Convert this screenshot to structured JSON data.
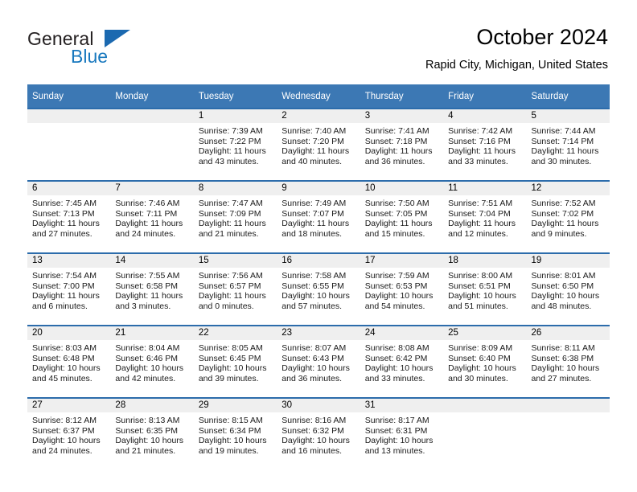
{
  "brand": {
    "name_part1": "General",
    "name_part2": "Blue",
    "accent_color": "#1b69b0"
  },
  "header": {
    "month_title": "October 2024",
    "location": "Rapid City, Michigan, United States"
  },
  "theme": {
    "header_blue": "#3c78b4",
    "row_rule_blue": "#2c6cab",
    "daynum_band": "#efefef"
  },
  "weekday_headers": [
    "Sunday",
    "Monday",
    "Tuesday",
    "Wednesday",
    "Thursday",
    "Friday",
    "Saturday"
  ],
  "labels": {
    "sunrise_prefix": "Sunrise:",
    "sunset_prefix": "Sunset:",
    "daylight_prefix": "Daylight:"
  },
  "weeks": [
    [
      {
        "day": "",
        "sunrise": "",
        "sunset": "",
        "daylight_line1": "",
        "daylight_line2": ""
      },
      {
        "day": "",
        "sunrise": "",
        "sunset": "",
        "daylight_line1": "",
        "daylight_line2": ""
      },
      {
        "day": "1",
        "sunrise": "Sunrise: 7:39 AM",
        "sunset": "Sunset: 7:22 PM",
        "daylight_line1": "Daylight: 11 hours",
        "daylight_line2": "and 43 minutes."
      },
      {
        "day": "2",
        "sunrise": "Sunrise: 7:40 AM",
        "sunset": "Sunset: 7:20 PM",
        "daylight_line1": "Daylight: 11 hours",
        "daylight_line2": "and 40 minutes."
      },
      {
        "day": "3",
        "sunrise": "Sunrise: 7:41 AM",
        "sunset": "Sunset: 7:18 PM",
        "daylight_line1": "Daylight: 11 hours",
        "daylight_line2": "and 36 minutes."
      },
      {
        "day": "4",
        "sunrise": "Sunrise: 7:42 AM",
        "sunset": "Sunset: 7:16 PM",
        "daylight_line1": "Daylight: 11 hours",
        "daylight_line2": "and 33 minutes."
      },
      {
        "day": "5",
        "sunrise": "Sunrise: 7:44 AM",
        "sunset": "Sunset: 7:14 PM",
        "daylight_line1": "Daylight: 11 hours",
        "daylight_line2": "and 30 minutes."
      }
    ],
    [
      {
        "day": "6",
        "sunrise": "Sunrise: 7:45 AM",
        "sunset": "Sunset: 7:13 PM",
        "daylight_line1": "Daylight: 11 hours",
        "daylight_line2": "and 27 minutes."
      },
      {
        "day": "7",
        "sunrise": "Sunrise: 7:46 AM",
        "sunset": "Sunset: 7:11 PM",
        "daylight_line1": "Daylight: 11 hours",
        "daylight_line2": "and 24 minutes."
      },
      {
        "day": "8",
        "sunrise": "Sunrise: 7:47 AM",
        "sunset": "Sunset: 7:09 PM",
        "daylight_line1": "Daylight: 11 hours",
        "daylight_line2": "and 21 minutes."
      },
      {
        "day": "9",
        "sunrise": "Sunrise: 7:49 AM",
        "sunset": "Sunset: 7:07 PM",
        "daylight_line1": "Daylight: 11 hours",
        "daylight_line2": "and 18 minutes."
      },
      {
        "day": "10",
        "sunrise": "Sunrise: 7:50 AM",
        "sunset": "Sunset: 7:05 PM",
        "daylight_line1": "Daylight: 11 hours",
        "daylight_line2": "and 15 minutes."
      },
      {
        "day": "11",
        "sunrise": "Sunrise: 7:51 AM",
        "sunset": "Sunset: 7:04 PM",
        "daylight_line1": "Daylight: 11 hours",
        "daylight_line2": "and 12 minutes."
      },
      {
        "day": "12",
        "sunrise": "Sunrise: 7:52 AM",
        "sunset": "Sunset: 7:02 PM",
        "daylight_line1": "Daylight: 11 hours",
        "daylight_line2": "and 9 minutes."
      }
    ],
    [
      {
        "day": "13",
        "sunrise": "Sunrise: 7:54 AM",
        "sunset": "Sunset: 7:00 PM",
        "daylight_line1": "Daylight: 11 hours",
        "daylight_line2": "and 6 minutes."
      },
      {
        "day": "14",
        "sunrise": "Sunrise: 7:55 AM",
        "sunset": "Sunset: 6:58 PM",
        "daylight_line1": "Daylight: 11 hours",
        "daylight_line2": "and 3 minutes."
      },
      {
        "day": "15",
        "sunrise": "Sunrise: 7:56 AM",
        "sunset": "Sunset: 6:57 PM",
        "daylight_line1": "Daylight: 11 hours",
        "daylight_line2": "and 0 minutes."
      },
      {
        "day": "16",
        "sunrise": "Sunrise: 7:58 AM",
        "sunset": "Sunset: 6:55 PM",
        "daylight_line1": "Daylight: 10 hours",
        "daylight_line2": "and 57 minutes."
      },
      {
        "day": "17",
        "sunrise": "Sunrise: 7:59 AM",
        "sunset": "Sunset: 6:53 PM",
        "daylight_line1": "Daylight: 10 hours",
        "daylight_line2": "and 54 minutes."
      },
      {
        "day": "18",
        "sunrise": "Sunrise: 8:00 AM",
        "sunset": "Sunset: 6:51 PM",
        "daylight_line1": "Daylight: 10 hours",
        "daylight_line2": "and 51 minutes."
      },
      {
        "day": "19",
        "sunrise": "Sunrise: 8:01 AM",
        "sunset": "Sunset: 6:50 PM",
        "daylight_line1": "Daylight: 10 hours",
        "daylight_line2": "and 48 minutes."
      }
    ],
    [
      {
        "day": "20",
        "sunrise": "Sunrise: 8:03 AM",
        "sunset": "Sunset: 6:48 PM",
        "daylight_line1": "Daylight: 10 hours",
        "daylight_line2": "and 45 minutes."
      },
      {
        "day": "21",
        "sunrise": "Sunrise: 8:04 AM",
        "sunset": "Sunset: 6:46 PM",
        "daylight_line1": "Daylight: 10 hours",
        "daylight_line2": "and 42 minutes."
      },
      {
        "day": "22",
        "sunrise": "Sunrise: 8:05 AM",
        "sunset": "Sunset: 6:45 PM",
        "daylight_line1": "Daylight: 10 hours",
        "daylight_line2": "and 39 minutes."
      },
      {
        "day": "23",
        "sunrise": "Sunrise: 8:07 AM",
        "sunset": "Sunset: 6:43 PM",
        "daylight_line1": "Daylight: 10 hours",
        "daylight_line2": "and 36 minutes."
      },
      {
        "day": "24",
        "sunrise": "Sunrise: 8:08 AM",
        "sunset": "Sunset: 6:42 PM",
        "daylight_line1": "Daylight: 10 hours",
        "daylight_line2": "and 33 minutes."
      },
      {
        "day": "25",
        "sunrise": "Sunrise: 8:09 AM",
        "sunset": "Sunset: 6:40 PM",
        "daylight_line1": "Daylight: 10 hours",
        "daylight_line2": "and 30 minutes."
      },
      {
        "day": "26",
        "sunrise": "Sunrise: 8:11 AM",
        "sunset": "Sunset: 6:38 PM",
        "daylight_line1": "Daylight: 10 hours",
        "daylight_line2": "and 27 minutes."
      }
    ],
    [
      {
        "day": "27",
        "sunrise": "Sunrise: 8:12 AM",
        "sunset": "Sunset: 6:37 PM",
        "daylight_line1": "Daylight: 10 hours",
        "daylight_line2": "and 24 minutes."
      },
      {
        "day": "28",
        "sunrise": "Sunrise: 8:13 AM",
        "sunset": "Sunset: 6:35 PM",
        "daylight_line1": "Daylight: 10 hours",
        "daylight_line2": "and 21 minutes."
      },
      {
        "day": "29",
        "sunrise": "Sunrise: 8:15 AM",
        "sunset": "Sunset: 6:34 PM",
        "daylight_line1": "Daylight: 10 hours",
        "daylight_line2": "and 19 minutes."
      },
      {
        "day": "30",
        "sunrise": "Sunrise: 8:16 AM",
        "sunset": "Sunset: 6:32 PM",
        "daylight_line1": "Daylight: 10 hours",
        "daylight_line2": "and 16 minutes."
      },
      {
        "day": "31",
        "sunrise": "Sunrise: 8:17 AM",
        "sunset": "Sunset: 6:31 PM",
        "daylight_line1": "Daylight: 10 hours",
        "daylight_line2": "and 13 minutes."
      },
      {
        "day": "",
        "sunrise": "",
        "sunset": "",
        "daylight_line1": "",
        "daylight_line2": ""
      },
      {
        "day": "",
        "sunrise": "",
        "sunset": "",
        "daylight_line1": "",
        "daylight_line2": ""
      }
    ]
  ]
}
